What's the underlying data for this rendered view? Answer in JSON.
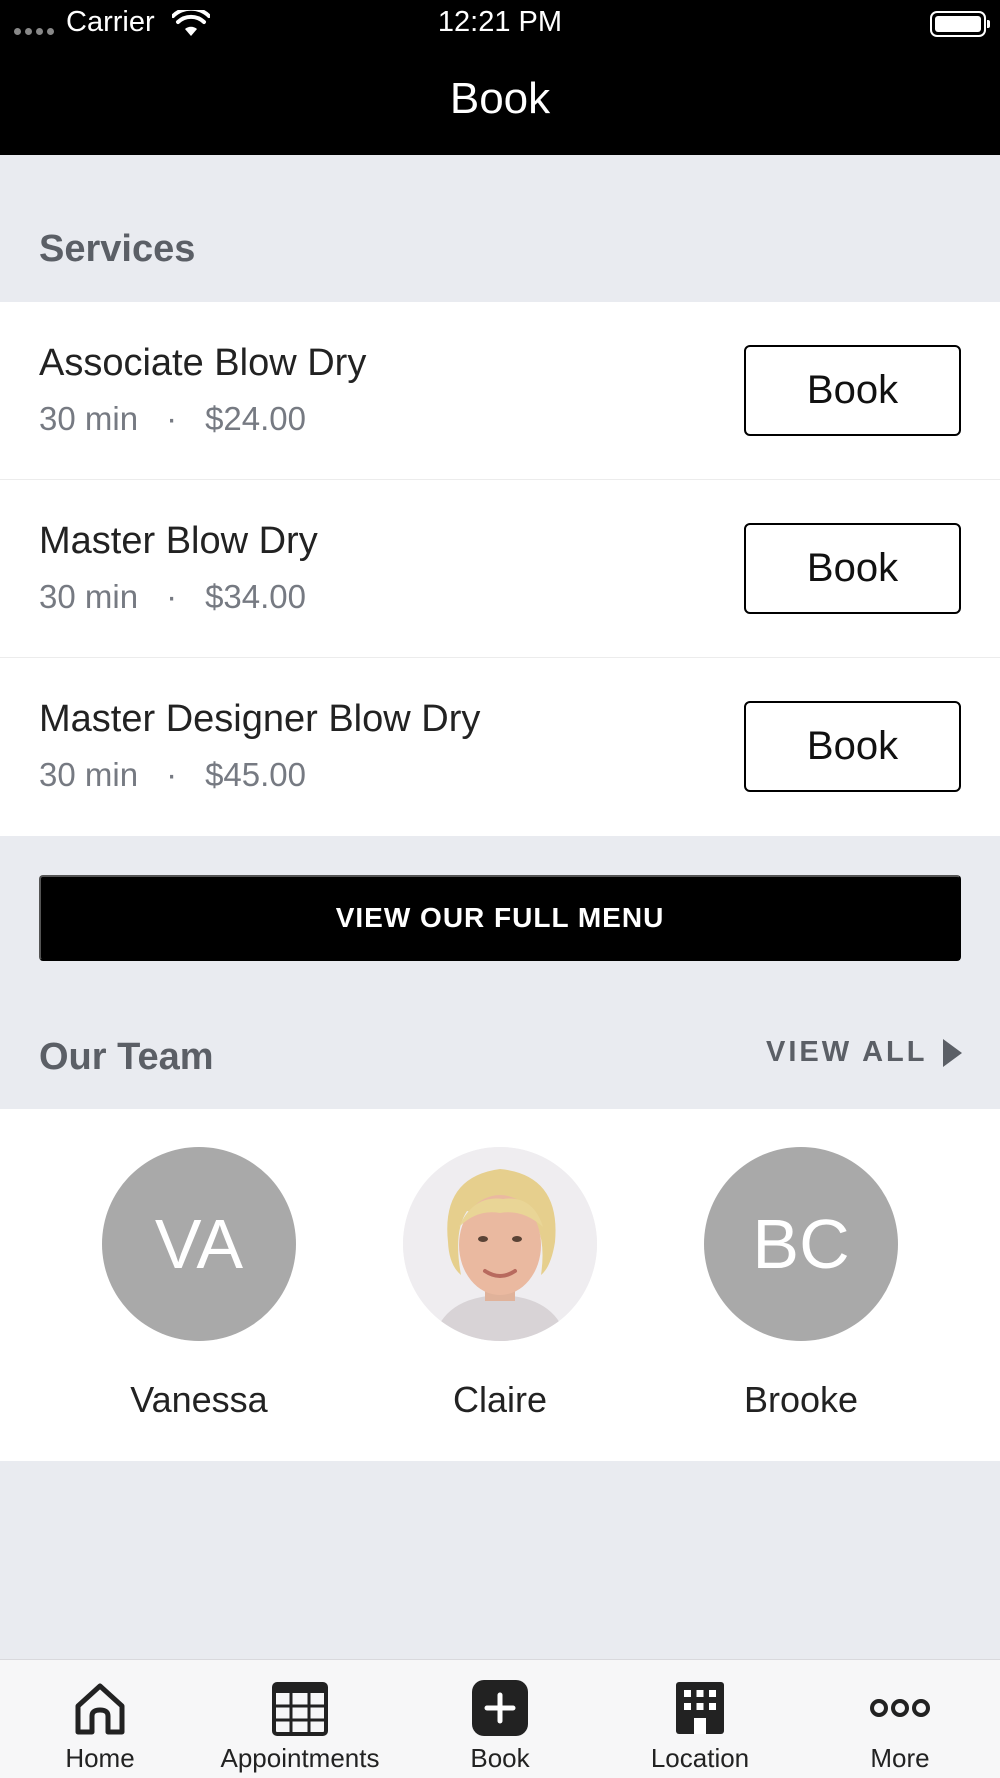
{
  "status_bar": {
    "carrier": "Carrier",
    "time": "12:21 PM"
  },
  "nav": {
    "title": "Book"
  },
  "services": {
    "title": "Services",
    "items": [
      {
        "name": "Associate Blow Dry",
        "duration": "30 min",
        "separator": "·",
        "price": "$24.00",
        "button": "Book"
      },
      {
        "name": "Master Blow Dry",
        "duration": "30 min",
        "separator": "·",
        "price": "$34.00",
        "button": "Book"
      },
      {
        "name": "Master Designer Blow Dry",
        "duration": "30 min",
        "separator": "·",
        "price": "$45.00",
        "button": "Book"
      }
    ],
    "menu_button": "VIEW OUR FULL MENU"
  },
  "team": {
    "title": "Our Team",
    "view_all": "VIEW ALL",
    "members": [
      {
        "name": "Vanessa",
        "initials": "VA"
      },
      {
        "name": "Claire",
        "initials": ""
      },
      {
        "name": "Brooke",
        "initials": "BC"
      }
    ]
  },
  "tab_bar": {
    "tabs": [
      {
        "label": "Home",
        "icon": "home-icon"
      },
      {
        "label": "Appointments",
        "icon": "calendar-grid-icon"
      },
      {
        "label": "Book",
        "icon": "plus-square-icon"
      },
      {
        "label": "Location",
        "icon": "building-icon"
      },
      {
        "label": "More",
        "icon": "more-dots-icon"
      }
    ]
  },
  "colors": {
    "header": "#000000",
    "background": "#e9ebf0",
    "avatar": "#a9a9a9",
    "section_title": "#5b5f66"
  }
}
